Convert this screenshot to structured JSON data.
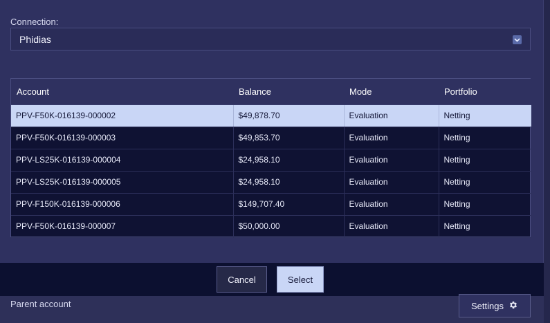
{
  "connection": {
    "label": "Connection:",
    "selected": "Phidias"
  },
  "table": {
    "columns": [
      "Account",
      "Balance",
      "Mode",
      "Portfolio"
    ],
    "rows": [
      {
        "account": "PPV-F50K-016139-000002",
        "balance": "$49,878.70",
        "mode": "Evaluation",
        "portfolio": "Netting",
        "selected": true
      },
      {
        "account": "PPV-F50K-016139-000003",
        "balance": "$49,853.70",
        "mode": "Evaluation",
        "portfolio": "Netting"
      },
      {
        "account": "PPV-LS25K-016139-000004",
        "balance": "$24,958.10",
        "mode": "Evaluation",
        "portfolio": "Netting"
      },
      {
        "account": "PPV-LS25K-016139-000005",
        "balance": "$24,958.10",
        "mode": "Evaluation",
        "portfolio": "Netting"
      },
      {
        "account": "PPV-F150K-016139-000006",
        "balance": "$149,707.40",
        "mode": "Evaluation",
        "portfolio": "Netting"
      },
      {
        "account": "PPV-F50K-016139-000007",
        "balance": "$50,000.00",
        "mode": "Evaluation",
        "portfolio": "Netting"
      }
    ]
  },
  "buttons": {
    "cancel": "Cancel",
    "select": "Select",
    "settings": "Settings"
  },
  "parent_account_label": "Parent account",
  "icons": {
    "dropdown": "chevron-down-icon",
    "settings": "gear-icon"
  },
  "colors": {
    "background": "#2f3160",
    "table_bg": "#0f1233",
    "selected_row": "#c9d6f6",
    "footer": "#0c1030"
  }
}
